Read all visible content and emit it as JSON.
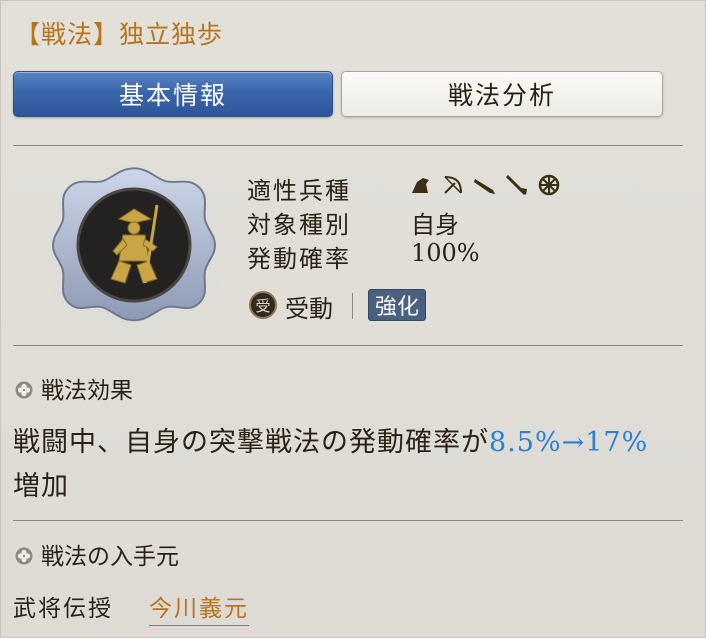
{
  "header": {
    "title": "【戦法】独立独歩"
  },
  "tabs": [
    {
      "label": "基本情報",
      "active": true
    },
    {
      "label": "戦法分析",
      "active": false
    }
  ],
  "info": {
    "troop_label": "適性兵種",
    "troop_icons": [
      "cavalry-icon",
      "archer-icon",
      "musket-icon",
      "spear-icon",
      "wheel-icon"
    ],
    "target_label": "対象種別",
    "target_value": "自身",
    "rate_label": "発動確率",
    "rate_value": "100%",
    "type_icon_glyph": "受",
    "type_label": "受動",
    "badge_label": "強化"
  },
  "effect": {
    "heading": "戦法効果",
    "text_before": "戦闘中、自身の突撃戦法の発動確率が",
    "highlight": "8.5%→17%",
    "text_after": "増加"
  },
  "source": {
    "heading": "戦法の入手元",
    "label": "武将伝授",
    "link": "今川義元"
  },
  "colors": {
    "title": "#b8741c",
    "tab_active": "#3b66ad",
    "highlight": "#2a7fd6",
    "badge": "#4a6080"
  }
}
